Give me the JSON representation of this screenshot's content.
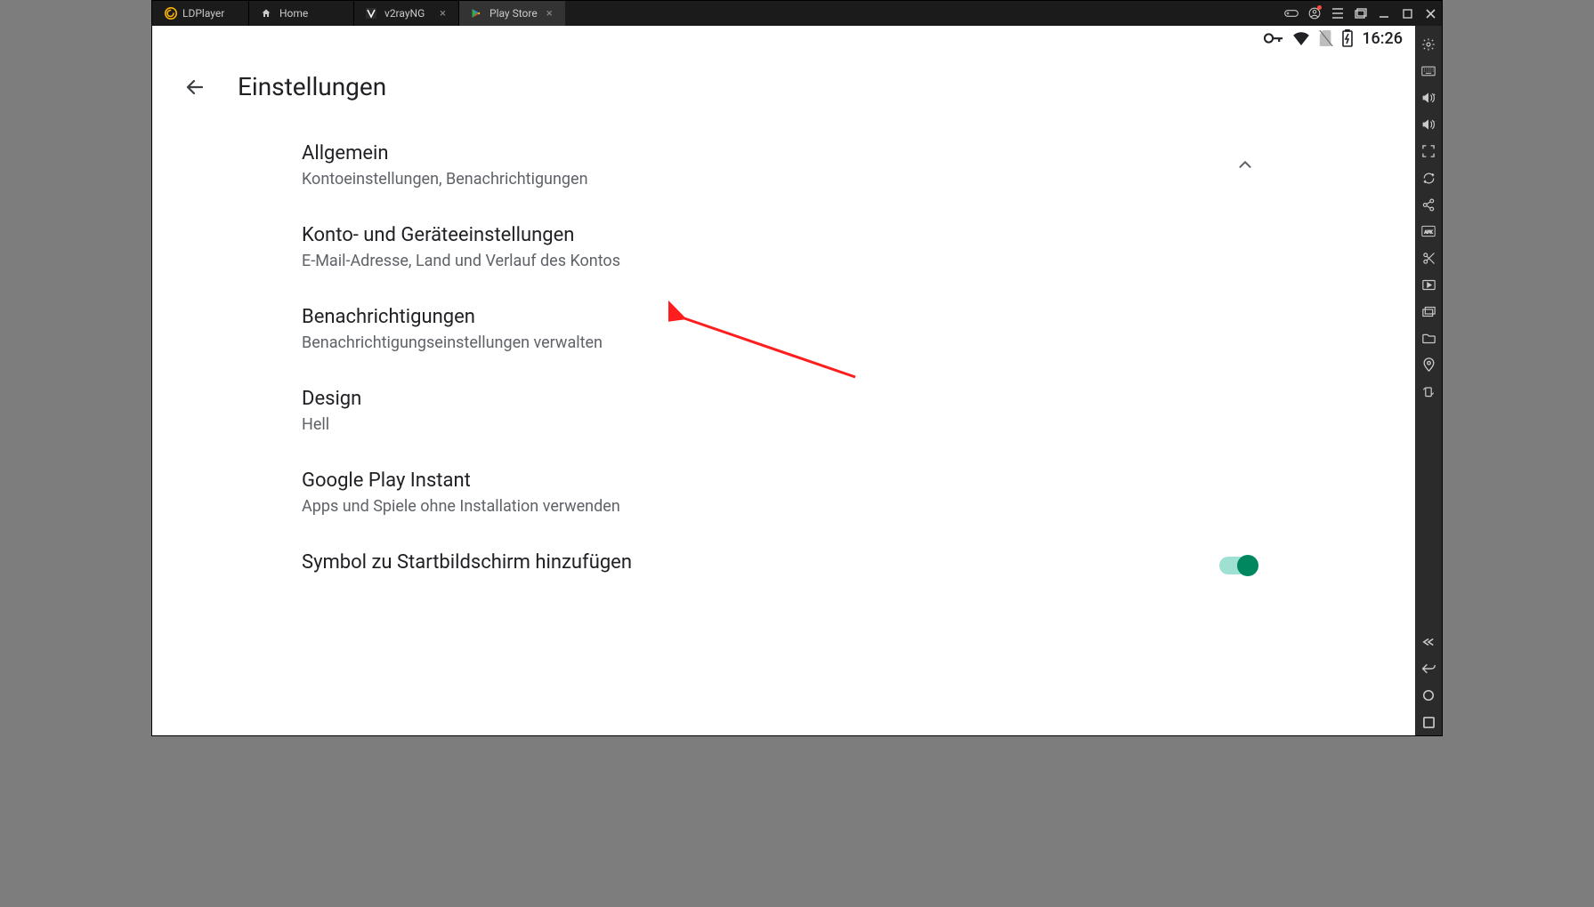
{
  "app": {
    "brand": "LDPlayer"
  },
  "tabs": [
    {
      "label": "Home",
      "icon": "home-icon",
      "active": false,
      "closable": false
    },
    {
      "label": "v2rayNG",
      "icon": "v2ray-icon",
      "active": false,
      "closable": true
    },
    {
      "label": "Play Store",
      "icon": "play-store-icon",
      "active": true,
      "closable": true
    }
  ],
  "statusbar": {
    "time": "16:26"
  },
  "page": {
    "title": "Einstellungen"
  },
  "settings": [
    {
      "title": "Allgemein",
      "subtitle": "Kontoeinstellungen, Benachrichtigungen",
      "expanded": true
    },
    {
      "title": "Konto- und Geräteeinstellungen",
      "subtitle": "E-Mail-Adresse, Land und Verlauf des Kontos"
    },
    {
      "title": "Benachrichtigungen",
      "subtitle": "Benachrichtigungseinstellungen verwalten"
    },
    {
      "title": "Design",
      "subtitle": "Hell"
    },
    {
      "title": "Google Play Instant",
      "subtitle": "Apps und Spiele ohne Installation verwenden"
    },
    {
      "title": "Symbol zu Startbildschirm hinzufügen",
      "toggle": true
    }
  ],
  "right_rail_icons": [
    "settings-gear-icon",
    "keyboard-icon",
    "volume-up-icon",
    "volume-down-icon",
    "fullscreen-icon",
    "sync-icon",
    "share-icon",
    "apk-icon",
    "scissors-icon",
    "play-video-icon",
    "multi-window-icon",
    "folder-icon",
    "location-pin-icon",
    "rotate-icon"
  ],
  "right_rail_bottom": [
    "expand-icon",
    "back-nav-icon",
    "home-nav-icon",
    "recent-nav-icon"
  ],
  "window_controls": [
    "gamepad-icon",
    "account-icon",
    "menu-icon",
    "multi-instance-icon",
    "minimize-icon",
    "maximize-icon",
    "close-icon"
  ]
}
